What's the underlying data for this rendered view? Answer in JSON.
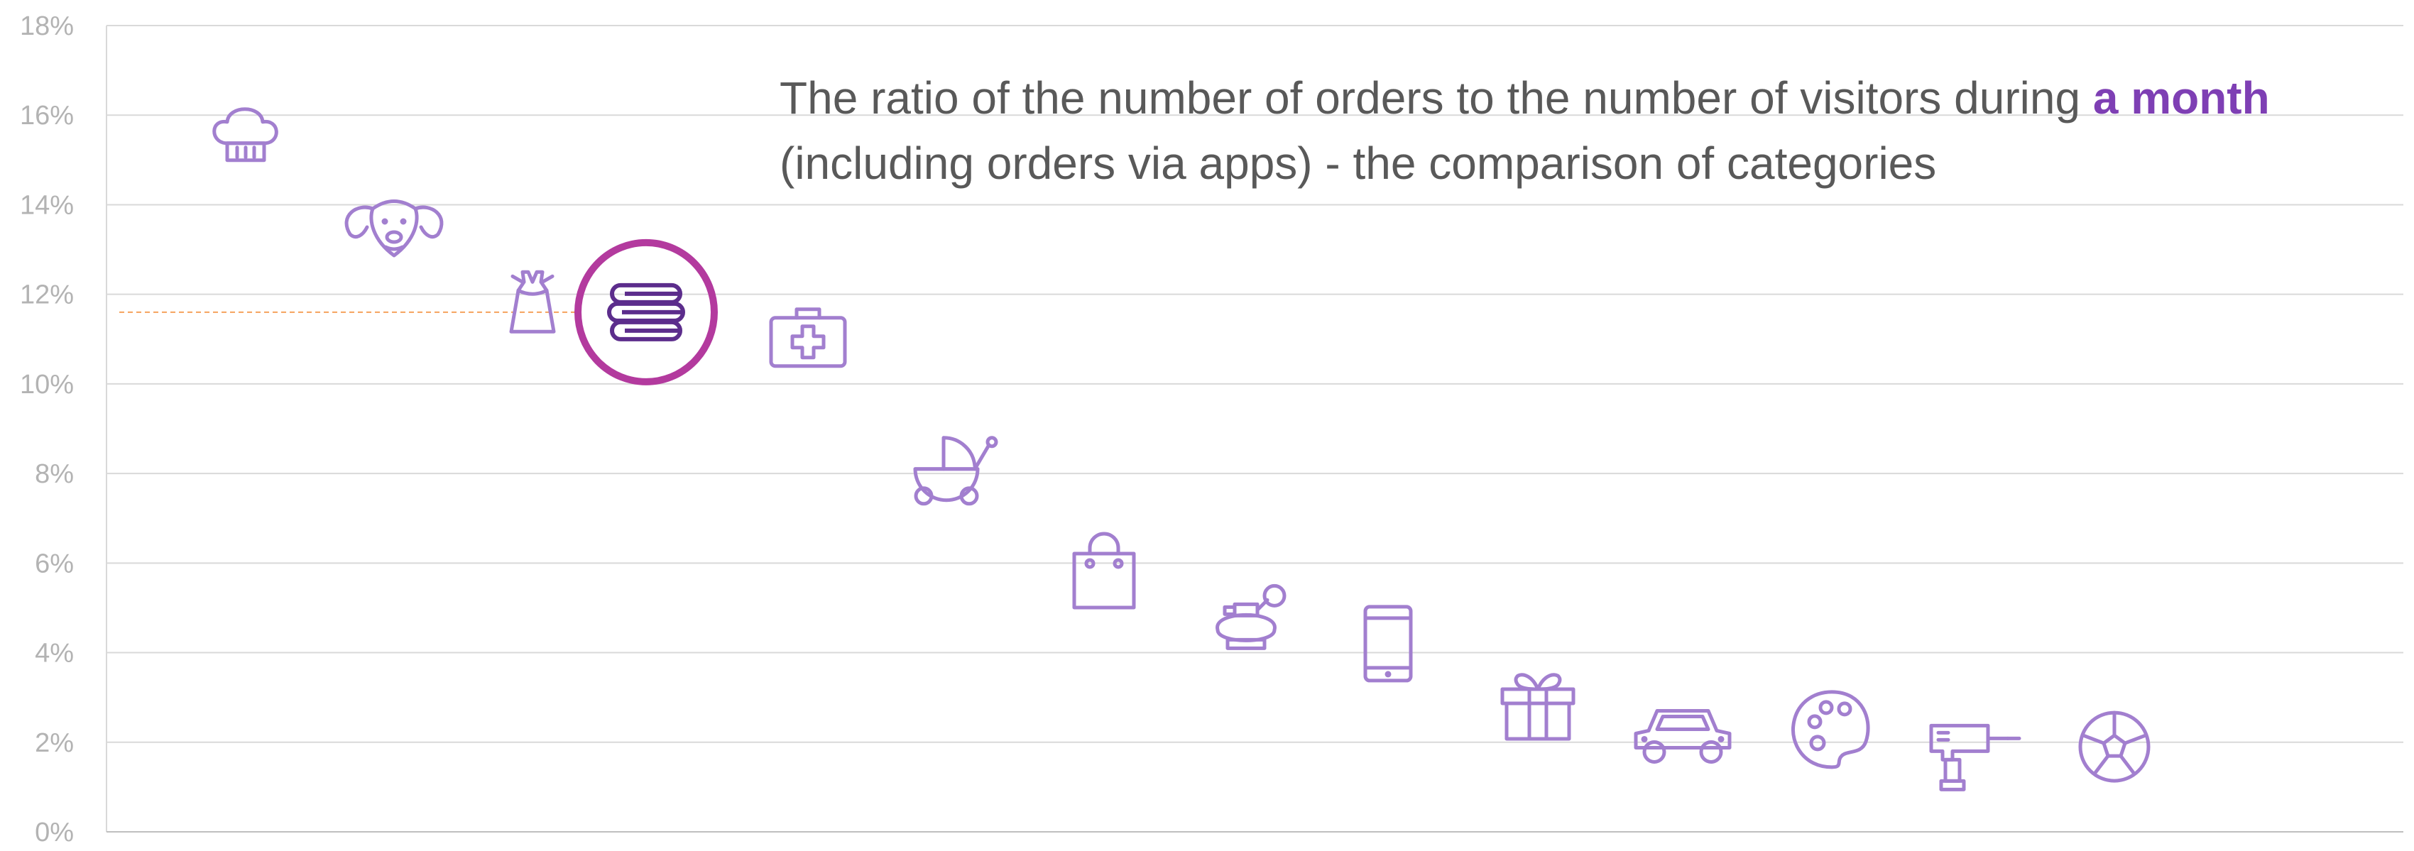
{
  "chart_data": {
    "type": "scatter",
    "title": {
      "line1_prefix": "The ratio of the number of orders to the number of visitors during ",
      "line1_highlight": "a month",
      "line2": "(including orders via apps) - the comparison of categories"
    },
    "xlabel": "",
    "ylabel": "",
    "ylim": [
      0,
      18
    ],
    "y_ticks": [
      "0%",
      "2%",
      "4%",
      "6%",
      "8%",
      "10%",
      "12%",
      "14%",
      "16%",
      "18%"
    ],
    "grid": true,
    "reference_line": 11.6,
    "highlighted_point": "books-icon",
    "points": [
      {
        "icon": "chef-hat-icon",
        "y": 15.5
      },
      {
        "icon": "dog-icon",
        "y": 13.5
      },
      {
        "icon": "dress-icon",
        "y": 11.8
      },
      {
        "icon": "books-icon",
        "y": 11.6
      },
      {
        "icon": "first-aid-kit-icon",
        "y": 11.0
      },
      {
        "icon": "baby-stroller-icon",
        "y": 8.1
      },
      {
        "icon": "shopping-bag-icon",
        "y": 5.8
      },
      {
        "icon": "perfume-icon",
        "y": 4.7
      },
      {
        "icon": "smartphone-icon",
        "y": 4.2
      },
      {
        "icon": "gift-icon",
        "y": 2.9
      },
      {
        "icon": "car-icon",
        "y": 2.1
      },
      {
        "icon": "palette-icon",
        "y": 2.3
      },
      {
        "icon": "drill-icon",
        "y": 1.8
      },
      {
        "icon": "soccer-ball-icon",
        "y": 1.9
      }
    ]
  },
  "colors": {
    "icon": "#a27fcf",
    "highlight_icon": "#5c2d8c",
    "highlight_ring": "#b33a9e",
    "reference_line": "#f5a25d",
    "grid": "#d9d9d9",
    "tick_label": "#b3b3b3",
    "title": "#595959",
    "title_highlight": "#7e3fb4"
  }
}
